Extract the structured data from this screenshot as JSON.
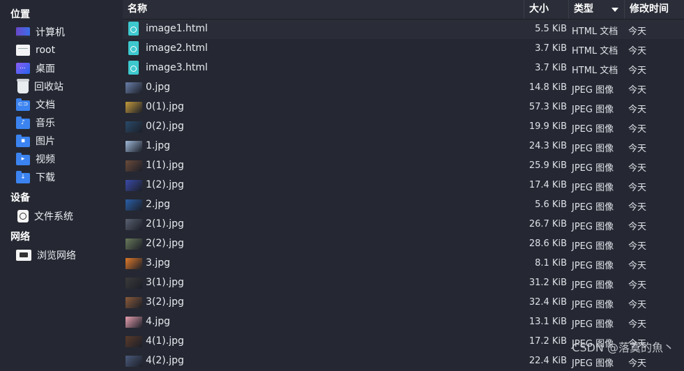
{
  "sidebar": {
    "places_label": "位置",
    "devices_label": "设备",
    "network_label": "网络",
    "places": [
      {
        "label": "计算机",
        "icon": "computer-icon"
      },
      {
        "label": "root",
        "icon": "home-folder-icon"
      },
      {
        "label": "桌面",
        "icon": "desktop-icon"
      },
      {
        "label": "回收站",
        "icon": "trash-icon"
      },
      {
        "label": "文档",
        "icon": "documents-folder-icon"
      },
      {
        "label": "音乐",
        "icon": "music-folder-icon"
      },
      {
        "label": "图片",
        "icon": "pictures-folder-icon"
      },
      {
        "label": "视频",
        "icon": "videos-folder-icon"
      },
      {
        "label": "下载",
        "icon": "downloads-folder-icon"
      }
    ],
    "devices": [
      {
        "label": "文件系统",
        "icon": "drive-icon"
      }
    ],
    "network": [
      {
        "label": "浏览网络",
        "icon": "network-icon"
      }
    ]
  },
  "header": {
    "name": "名称",
    "size": "大小",
    "type": "类型",
    "modified": "修改时间"
  },
  "files": [
    {
      "name": "image1.html",
      "size": "5.5 KiB",
      "type": "HTML 文档",
      "date": "今天",
      "kind": "html"
    },
    {
      "name": "image2.html",
      "size": "3.7 KiB",
      "type": "HTML 文档",
      "date": "今天",
      "kind": "html"
    },
    {
      "name": "image3.html",
      "size": "3.7 KiB",
      "type": "HTML 文档",
      "date": "今天",
      "kind": "html"
    },
    {
      "name": "0.jpg",
      "size": "14.8 KiB",
      "type": "JPEG 图像",
      "date": "今天",
      "kind": "jpg"
    },
    {
      "name": "0(1).jpg",
      "size": "57.3 KiB",
      "type": "JPEG 图像",
      "date": "今天",
      "kind": "jpg"
    },
    {
      "name": "0(2).jpg",
      "size": "19.9 KiB",
      "type": "JPEG 图像",
      "date": "今天",
      "kind": "jpg"
    },
    {
      "name": "1.jpg",
      "size": "24.3 KiB",
      "type": "JPEG 图像",
      "date": "今天",
      "kind": "jpg"
    },
    {
      "name": "1(1).jpg",
      "size": "25.9 KiB",
      "type": "JPEG 图像",
      "date": "今天",
      "kind": "jpg"
    },
    {
      "name": "1(2).jpg",
      "size": "17.4 KiB",
      "type": "JPEG 图像",
      "date": "今天",
      "kind": "jpg"
    },
    {
      "name": "2.jpg",
      "size": "5.6 KiB",
      "type": "JPEG 图像",
      "date": "今天",
      "kind": "jpg"
    },
    {
      "name": "2(1).jpg",
      "size": "26.7 KiB",
      "type": "JPEG 图像",
      "date": "今天",
      "kind": "jpg"
    },
    {
      "name": "2(2).jpg",
      "size": "28.6 KiB",
      "type": "JPEG 图像",
      "date": "今天",
      "kind": "jpg"
    },
    {
      "name": "3.jpg",
      "size": "8.1 KiB",
      "type": "JPEG 图像",
      "date": "今天",
      "kind": "jpg"
    },
    {
      "name": "3(1).jpg",
      "size": "31.2 KiB",
      "type": "JPEG 图像",
      "date": "今天",
      "kind": "jpg"
    },
    {
      "name": "3(2).jpg",
      "size": "32.4 KiB",
      "type": "JPEG 图像",
      "date": "今天",
      "kind": "jpg"
    },
    {
      "name": "4.jpg",
      "size": "13.1 KiB",
      "type": "JPEG 图像",
      "date": "今天",
      "kind": "jpg"
    },
    {
      "name": "4(1).jpg",
      "size": "17.2 KiB",
      "type": "JPEG 图像",
      "date": "今天",
      "kind": "jpg"
    },
    {
      "name": "4(2).jpg",
      "size": "22.4 KiB",
      "type": "JPEG 图像",
      "date": "今天",
      "kind": "jpg"
    }
  ],
  "thumb_colors": [
    "#6a7fa8",
    "#c49a3c",
    "#2a4a6a",
    "#9fb8d8",
    "#6b4a3a",
    "#3a4aa8",
    "#2a5fa8",
    "#5a6070",
    "#6a7a5a",
    "#e07a2a",
    "#3a3a3a",
    "#8a5a3a",
    "#e8a0b0",
    "#5a3a2a",
    "#4a5a7a"
  ],
  "watermark": "CSDN @落寞的魚丶"
}
